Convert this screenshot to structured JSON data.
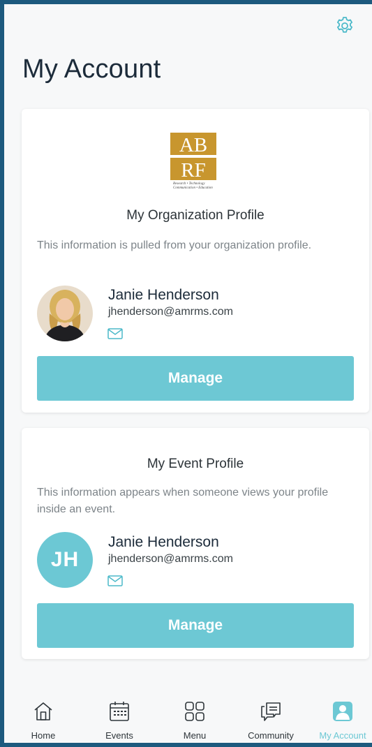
{
  "page": {
    "title": "My Account"
  },
  "header": {
    "settings_icon": "gear-icon"
  },
  "org_profile": {
    "logo_text_top": "AB",
    "logo_text_bottom": "RF",
    "logo_tagline_1": "Research • Technology",
    "logo_tagline_2": "Communication • Education",
    "title": "My Organization Profile",
    "description": "This information is pulled from your organization profile.",
    "name": "Janie Henderson",
    "email": "jhenderson@amrms.com",
    "manage_label": "Manage"
  },
  "event_profile": {
    "title": "My Event Profile",
    "description": "This information appears when someone views your profile inside an event.",
    "initials": "JH",
    "name": "Janie Henderson",
    "email": "jhenderson@amrms.com",
    "manage_label": "Manage"
  },
  "tabbar": {
    "tabs": [
      {
        "label": "Home",
        "icon": "home-icon"
      },
      {
        "label": "Events",
        "icon": "calendar-icon"
      },
      {
        "label": "Menu",
        "icon": "grid-icon"
      },
      {
        "label": "Community",
        "icon": "chat-icon"
      },
      {
        "label": "My Account",
        "icon": "person-icon",
        "active": true
      }
    ]
  },
  "colors": {
    "accent": "#6dc8d4",
    "logo_gold": "#c8962e",
    "frame": "#1d5a7e"
  }
}
